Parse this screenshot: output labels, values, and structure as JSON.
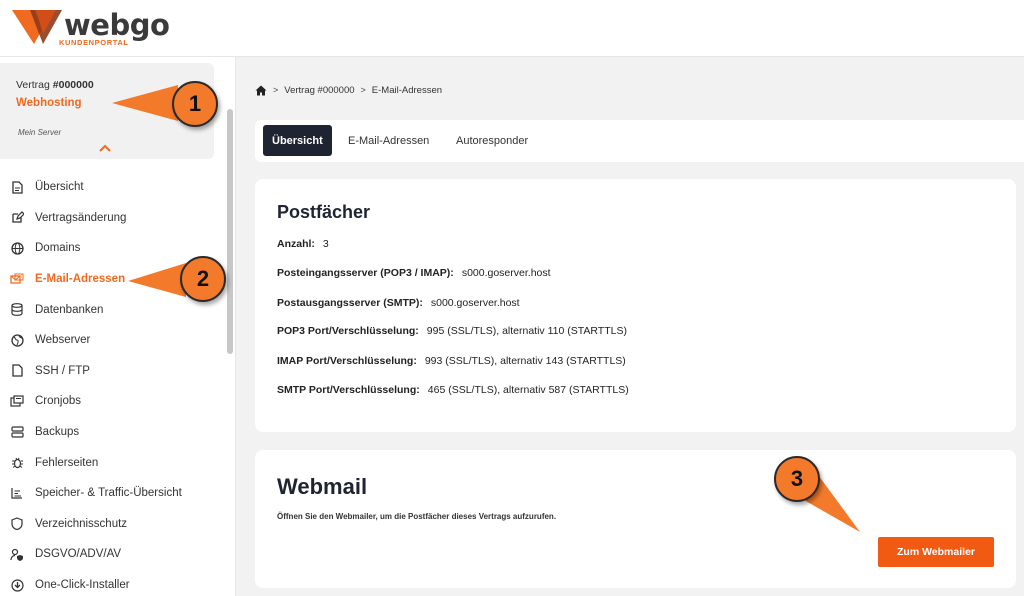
{
  "brand": {
    "name": "webgo",
    "subtitle": "KUNDENPORTAL",
    "accent_color": "#f06a1f",
    "dark_color": "#1e2432"
  },
  "contract": {
    "label": "Vertrag",
    "number": "#000000",
    "type": "Webhosting",
    "server": "Mein Server"
  },
  "sidebar": {
    "items": [
      {
        "label": "Übersicht",
        "icon": "document-icon",
        "active": false
      },
      {
        "label": "Vertragsänderung",
        "icon": "edit-icon",
        "active": false
      },
      {
        "label": "Domains",
        "icon": "globe-icon",
        "active": false
      },
      {
        "label": "E-Mail-Adressen",
        "icon": "mail-icon",
        "active": true
      },
      {
        "label": "Datenbanken",
        "icon": "database-icon",
        "active": false
      },
      {
        "label": "Webserver",
        "icon": "webserver-globe-icon",
        "active": false
      },
      {
        "label": "SSH / FTP",
        "icon": "file-icon",
        "active": false
      },
      {
        "label": "Cronjobs",
        "icon": "cronjobs-icon",
        "active": false
      },
      {
        "label": "Backups",
        "icon": "backup-server-icon",
        "active": false
      },
      {
        "label": "Fehlerseiten",
        "icon": "bug-icon",
        "active": false
      },
      {
        "label": "Speicher- & Traffic-Übersicht",
        "icon": "bar-chart-icon",
        "active": false
      },
      {
        "label": "Verzeichnisschutz",
        "icon": "shield-icon",
        "active": false
      },
      {
        "label": "DSGVO/ADV/AV",
        "icon": "user-shield-icon",
        "active": false
      },
      {
        "label": "One-Click-Installer",
        "icon": "download-circle-icon",
        "active": false
      }
    ]
  },
  "breadcrumb": {
    "items": [
      "Vertrag #000000",
      "E-Mail-Adressen"
    ]
  },
  "tabs": [
    {
      "label": "Übersicht",
      "active": true
    },
    {
      "label": "E-Mail-Adressen",
      "active": false
    },
    {
      "label": "Autoresponder",
      "active": false
    }
  ],
  "postfaecher": {
    "title": "Postfächer",
    "rows": [
      {
        "key": "Anzahl:",
        "value": "3"
      },
      {
        "key": "Posteingangsserver (POP3 / IMAP):",
        "value": "s000.goserver.host"
      },
      {
        "key": "Postausgangsserver (SMTP):",
        "value": "s000.goserver.host"
      },
      {
        "key": "POP3 Port/Verschlüsselung:",
        "value": "995 (SSL/TLS), alternativ 110 (STARTTLS)"
      },
      {
        "key": "IMAP Port/Verschlüsselung:",
        "value": "993 (SSL/TLS), alternativ 143 (STARTTLS)"
      },
      {
        "key": "SMTP Port/Verschlüsselung:",
        "value": "465 (SSL/TLS), alternativ 587 (STARTTLS)"
      }
    ]
  },
  "webmail": {
    "title": "Webmail",
    "description": "Öffnen Sie den Webmailer, um die Postfächer dieses Vertrags aufzurufen.",
    "button_label": "Zum Webmailer",
    "button_color": "#f05a13"
  },
  "annotations": {
    "badges": [
      "1",
      "2",
      "3"
    ],
    "color": "#f47a2b"
  }
}
